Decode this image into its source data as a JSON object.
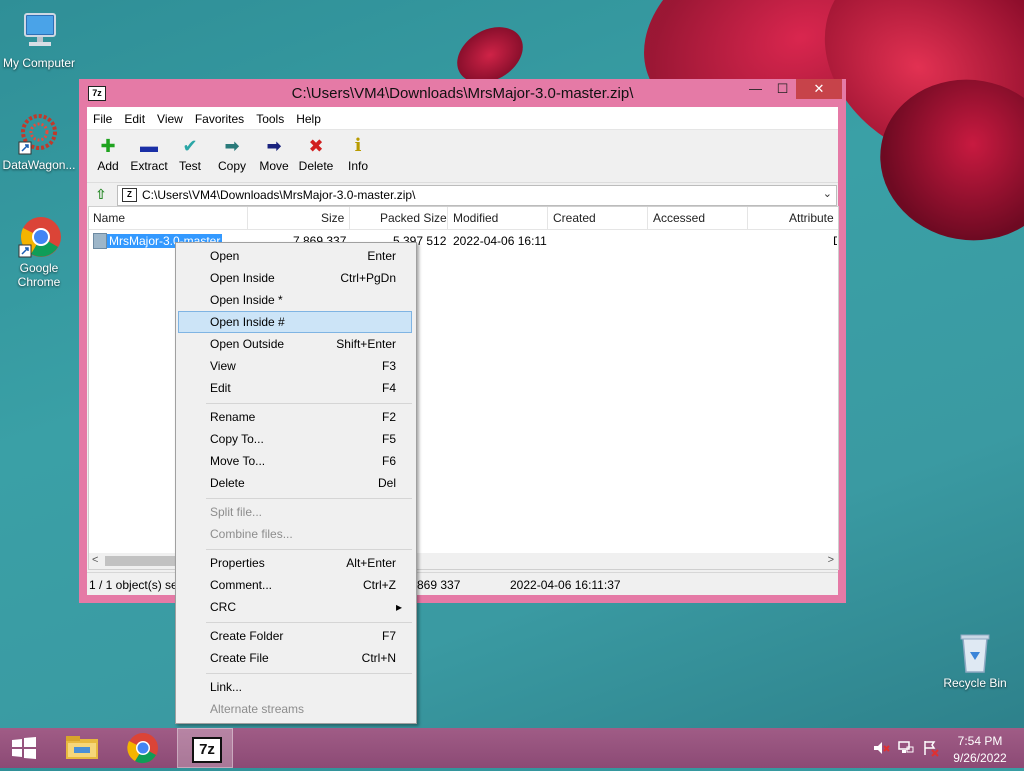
{
  "desktop": {
    "icons": [
      {
        "label": "My Computer"
      },
      {
        "label": "DataWagon..."
      },
      {
        "label": "Google Chrome"
      },
      {
        "label": "Recycle Bin"
      }
    ]
  },
  "window": {
    "app_icon": "7z",
    "title": "C:\\Users\\VM4\\Downloads\\MrsMajor-3.0-master.zip\\",
    "controls": {
      "minimize": "—",
      "maximize": "☐",
      "close": "✕"
    }
  },
  "menu": [
    "File",
    "Edit",
    "View",
    "Favorites",
    "Tools",
    "Help"
  ],
  "toolbar": [
    {
      "label": "Add",
      "icon": "add-icon",
      "glyph": "✚",
      "color": "#1fa31f"
    },
    {
      "label": "Extract",
      "icon": "extract-icon",
      "glyph": "▬",
      "color": "#1a2fa6"
    },
    {
      "label": "Test",
      "icon": "test-icon",
      "glyph": "✔",
      "color": "#2aa6a6"
    },
    {
      "label": "Copy",
      "icon": "copy-icon",
      "glyph": "➡",
      "color": "#2a7a7a"
    },
    {
      "label": "Move",
      "icon": "move-icon",
      "glyph": "➡",
      "color": "#1a237e"
    },
    {
      "label": "Delete",
      "icon": "delete-icon",
      "glyph": "✖",
      "color": "#d11f1f"
    },
    {
      "label": "Info",
      "icon": "info-icon",
      "glyph": "i",
      "color": "#b89b00"
    }
  ],
  "address": {
    "value": "C:\\Users\\VM4\\Downloads\\MrsMajor-3.0-master.zip\\",
    "icon": "Z"
  },
  "columns": [
    "Name",
    "Size",
    "Packed Size",
    "Modified",
    "Created",
    "Accessed",
    "Attribute"
  ],
  "rows": [
    {
      "name": "MrsMajor-3.0-master",
      "size": "7 869 337",
      "packed": "5 397 512",
      "modified": "2022-04-06 16:11",
      "created": "",
      "accessed": "",
      "attr": "D"
    }
  ],
  "status": {
    "count": "1 / 1 object(s) se",
    "size": "869 337",
    "date": "2022-04-06 16:11:37"
  },
  "context_menu": {
    "highlighted": "Open Inside #",
    "items": [
      {
        "label": "Open",
        "shortcut": "Enter"
      },
      {
        "label": "Open Inside",
        "shortcut": "Ctrl+PgDn"
      },
      {
        "label": "Open Inside *",
        "shortcut": ""
      },
      {
        "label": "Open Inside #",
        "shortcut": ""
      },
      {
        "label": "Open Outside",
        "shortcut": "Shift+Enter"
      },
      {
        "label": "View",
        "shortcut": "F3"
      },
      {
        "label": "Edit",
        "shortcut": "F4"
      },
      {
        "label": "Rename",
        "shortcut": "F2"
      },
      {
        "label": "Copy To...",
        "shortcut": "F5"
      },
      {
        "label": "Move To...",
        "shortcut": "F6"
      },
      {
        "label": "Delete",
        "shortcut": "Del"
      },
      {
        "label": "Split file...",
        "shortcut": ""
      },
      {
        "label": "Combine files...",
        "shortcut": ""
      },
      {
        "label": "Properties",
        "shortcut": "Alt+Enter"
      },
      {
        "label": "Comment...",
        "shortcut": "Ctrl+Z"
      },
      {
        "label": "CRC",
        "shortcut": "▸"
      },
      {
        "label": "Create Folder",
        "shortcut": "F7"
      },
      {
        "label": "Create File",
        "shortcut": "Ctrl+N"
      },
      {
        "label": "Link...",
        "shortcut": ""
      },
      {
        "label": "Alternate streams",
        "shortcut": ""
      }
    ]
  },
  "taskbar": {
    "start_icon": "windows-logo",
    "items": [
      "file-explorer",
      "google-chrome",
      "7-zip"
    ],
    "active": "7-zip",
    "active_label": "7z"
  },
  "clock": {
    "time": "7:54 PM",
    "date": "9/26/2022"
  }
}
